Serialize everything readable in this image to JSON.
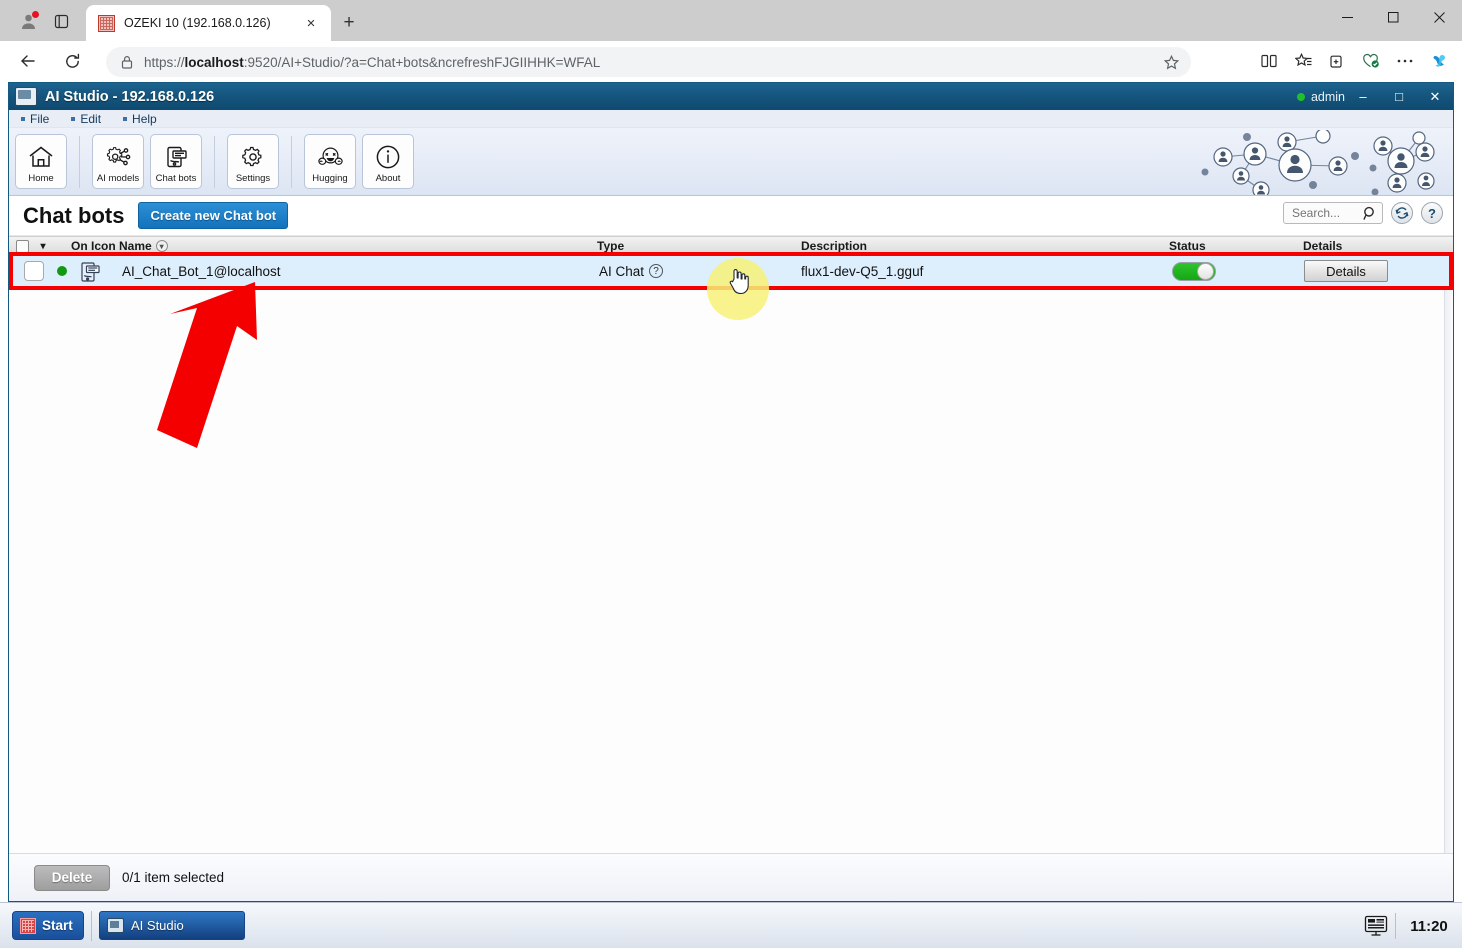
{
  "browser": {
    "tab": {
      "title": "OZEKI 10 (192.168.0.126)",
      "favicon": "ozeki-favicon",
      "close": "×"
    },
    "newtab_label": "+",
    "url_prefix": "https://",
    "url_bold": "localhost",
    "url_rest": ":9520/AI+Studio/?a=Chat+bots&ncrefreshFJGIIHHK=WFAL",
    "window_controls": {
      "minimize": "–",
      "maximize": "□",
      "close": "×"
    },
    "toolbar_icons": [
      "split-screen-icon",
      "favorites-icon",
      "collections-icon",
      "browser-essentials-icon",
      "settings-more-icon",
      "copilot-icon"
    ]
  },
  "app": {
    "title": "AI Studio - 192.168.0.126",
    "user": "admin",
    "window_controls": {
      "minimize": "–",
      "maximize": "□",
      "close": "✕"
    },
    "menu": [
      {
        "label": "File"
      },
      {
        "label": "Edit"
      },
      {
        "label": "Help"
      }
    ],
    "ribbon": [
      {
        "label": "Home",
        "icon": "home-icon"
      },
      {
        "label": "AI models",
        "icon": "gear-network-icon"
      },
      {
        "label": "Chat bots",
        "icon": "chat-bots-icon"
      },
      {
        "label": "Settings",
        "icon": "gear-icon"
      },
      {
        "label": "Hugging",
        "icon": "hugging-face-icon"
      },
      {
        "label": "About",
        "icon": "info-icon"
      }
    ]
  },
  "page": {
    "title": "Chat bots",
    "create_button": "Create new Chat bot",
    "search_placeholder": "Search...",
    "search_value": "",
    "refresh_label": "↻",
    "help_label": "?"
  },
  "grid": {
    "columns": [
      "On",
      "Icon",
      "Name",
      "Type",
      "Description",
      "Status",
      "Details"
    ],
    "header_name_group": "On Icon Name",
    "rows": [
      {
        "checked": false,
        "led": "online",
        "icon": "chat-bot-icon",
        "name": "AI_Chat_Bot_1@localhost",
        "type": "AI Chat",
        "type_help": "?",
        "description": "flux1-dev-Q5_1.gguf",
        "status_on": true,
        "details_button": "Details"
      }
    ]
  },
  "footer": {
    "delete_button": "Delete",
    "selection_text": "0/1 item selected"
  },
  "taskbar": {
    "start_label": "Start",
    "items": [
      {
        "label": "AI Studio",
        "icon": "ai-studio-icon"
      }
    ],
    "tray_icon": "show-desktop-icon",
    "clock": "11:20"
  },
  "annotations": {
    "highlight_color": "#f40000",
    "cursor_halo_color": "#f7f178",
    "arrow_color": "#f40000"
  }
}
